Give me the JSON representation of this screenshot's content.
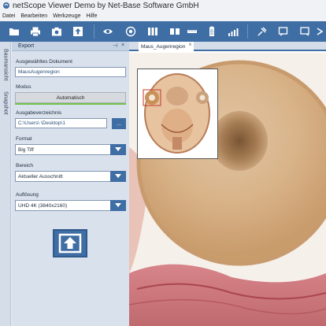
{
  "window": {
    "title": "netScope Viewer Demo by Net-Base Software GmbH"
  },
  "menu": {
    "items": [
      "Datei",
      "Bearbeiten",
      "Werkzeuge",
      "Hilfe"
    ]
  },
  "side_tabs": {
    "tab1": "Baumansicht",
    "tab2": "Snapshot"
  },
  "export_panel": {
    "title": "Export",
    "pin_icon": "pin",
    "close_icon": "×",
    "selected_doc_label": "Ausgewähltes Dokument",
    "selected_doc_value": "MausAugenregion",
    "mode_label": "Modus",
    "mode_button": "Automatisch",
    "output_dir_label": "Ausgabeverzeichnis",
    "output_dir_value": "C:\\Users\\            \\Desktop\\1",
    "browse_label": "...",
    "format_label": "Format",
    "format_value": "Big Tiff",
    "area_label": "Bereich",
    "area_value": "Aktueller Ausschnitt",
    "resolution_label": "Auflösung",
    "resolution_value": "UHD 4K (3840x2160)"
  },
  "viewer": {
    "tab_label": "Maus_Augenregion",
    "tab_close": "x"
  },
  "colors": {
    "accent": "#3f6ea4",
    "mode_bar": "#74c24a",
    "panel_bg": "#d9e1ec"
  },
  "icons": [
    "folder-icon",
    "print-icon",
    "camera-icon",
    "upload-icon",
    "eye-icon",
    "eye-settings-icon",
    "slides-icon",
    "ruler-icon",
    "battery-icon",
    "bars-icon",
    "pin-icon",
    "window-icon",
    "screen-icon",
    "arrow-icon"
  ]
}
